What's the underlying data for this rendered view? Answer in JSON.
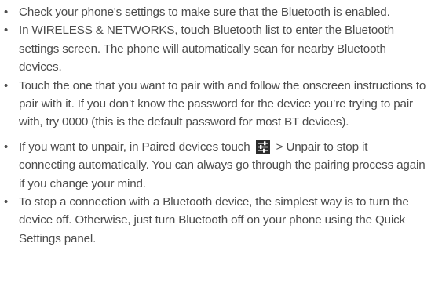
{
  "bullet_glyph": "•",
  "items": [
    {
      "text": "Check your phone's settings to make sure that the Bluetooth is enabled."
    },
    {
      "text": "In WIRELESS & NETWORKS, touch Bluetooth list to enter the Bluetooth settings screen. The phone will automatically scan for nearby Bluetooth devices."
    },
    {
      "text": "Touch the one that you want to pair with and follow the onscreen instructions to pair with it. If you don’t know the password for the device you’re trying to pair with, try 0000 (this is the default password for most BT devices)."
    },
    {
      "text_before_icon": "If you want to unpair, in Paired devices touch",
      "icon": "settings-sliders-icon",
      "text_after_icon": "> Unpair to stop it connecting automatically. You can always go through the pairing process again if you change your mind."
    },
    {
      "text": "To stop a connection with a Bluetooth device, the simplest way is to turn the device off. Otherwise, just turn Bluetooth off on your phone using the Quick Settings panel."
    }
  ],
  "colors": {
    "text": "#4d4d4d",
    "icon_background": "#2b2b2b",
    "icon_foreground": "#ffffff"
  }
}
